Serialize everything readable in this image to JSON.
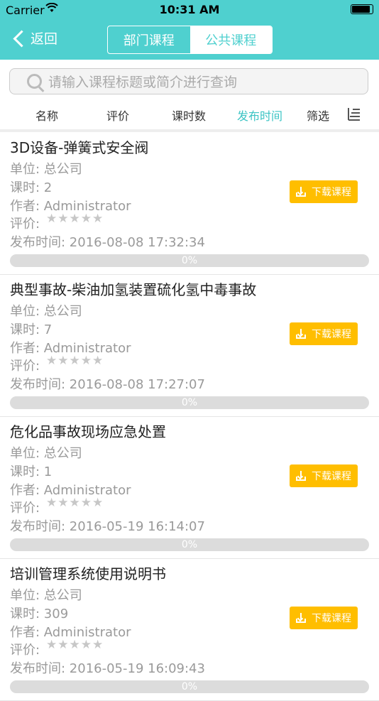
{
  "status_bar": {
    "carrier": "Carrier",
    "time": "10:31 AM"
  },
  "nav": {
    "back_label": "返回",
    "segments": [
      {
        "label": "部门课程",
        "active": false
      },
      {
        "label": "公共课程",
        "active": true
      }
    ]
  },
  "search": {
    "placeholder": "请输入课程标题或简介进行查询"
  },
  "sort": {
    "items": [
      {
        "label": "名称",
        "active": false
      },
      {
        "label": "评价",
        "active": false
      },
      {
        "label": "课时数",
        "active": false
      },
      {
        "label": "发布时间",
        "active": true
      },
      {
        "label": "筛选",
        "active": false
      }
    ]
  },
  "colors": {
    "header": "#4fd0cf",
    "accent": "#3cc4c4",
    "download": "#ffbe00"
  },
  "courses": [
    {
      "title": "3D设备-弹簧式安全阀",
      "unit": "单位: 总公司",
      "hours": "课时: 2",
      "author": "作者: Administrator",
      "rating_label": "评价:",
      "rating": 0,
      "published": "发布时间: 2016-08-08 17:32:34",
      "download_label": "下载课程",
      "progress": 0,
      "progress_text": "0%"
    },
    {
      "title": "典型事故-柴油加氢装置硫化氢中毒事故",
      "unit": "单位: 总公司",
      "hours": "课时: 7",
      "author": "作者: Administrator",
      "rating_label": "评价:",
      "rating": 0,
      "published": "发布时间: 2016-08-08 17:27:07",
      "download_label": "下载课程",
      "progress": 0,
      "progress_text": "0%"
    },
    {
      "title": "危化品事故现场应急处置",
      "unit": "单位: 总公司",
      "hours": "课时: 1",
      "author": "作者: Administrator",
      "rating_label": "评价:",
      "rating": 0,
      "published": "发布时间: 2016-05-19 16:14:07",
      "download_label": "下载课程",
      "progress": 0,
      "progress_text": "0%"
    },
    {
      "title": "培训管理系统使用说明书",
      "unit": "单位: 总公司",
      "hours": "课时: 309",
      "author": "作者: Administrator",
      "rating_label": "评价:",
      "rating": 0,
      "published": "发布时间: 2016-05-19 16:09:43",
      "download_label": "下载课程",
      "progress": 0,
      "progress_text": "0%"
    }
  ]
}
